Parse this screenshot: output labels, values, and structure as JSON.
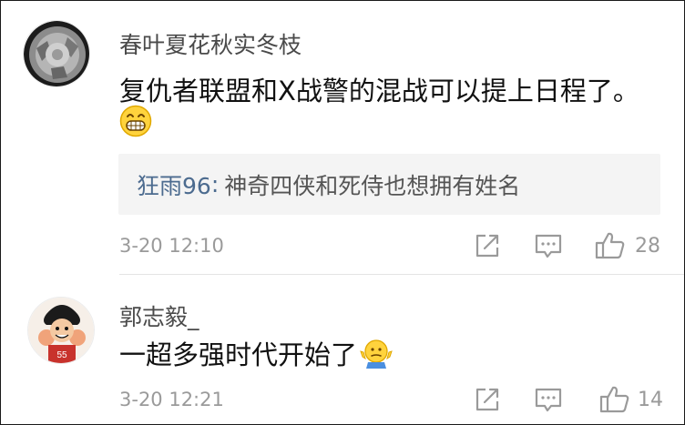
{
  "comments": [
    {
      "username": "春叶夏花秋实冬枝",
      "text": "复仇者联盟和X战警的混战可以提上日程了。",
      "emoji": "grinning-face-icon",
      "reply": {
        "user": "狂雨96",
        "separator": ":",
        "text": "神奇四侠和死侍也想拥有姓名"
      },
      "timestamp": "3-20 12:10",
      "likes": "28"
    },
    {
      "username": "郭志毅_",
      "text": "一超多强时代开始了",
      "emoji": "shrug-face-icon",
      "timestamp": "3-20 12:21",
      "likes": "14"
    }
  ],
  "colors": {
    "reply_user": "#4c6b8f",
    "meta_gray": "#9a9a9a",
    "reply_bg": "#f4f4f4"
  }
}
